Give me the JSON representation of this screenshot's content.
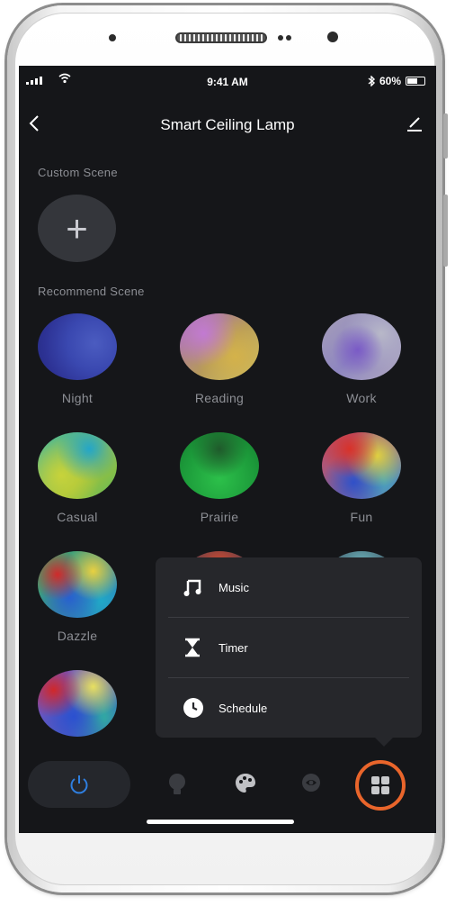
{
  "status_bar": {
    "time": "9:41 AM",
    "battery": "60%",
    "battery_level": 0.6
  },
  "header": {
    "title": "Smart Ceiling Lamp",
    "back_icon": "chevron-left-icon",
    "edit_icon": "pencil-icon"
  },
  "custom_scene": {
    "heading": "Custom Scene",
    "add_symbol": "+"
  },
  "recommend_scene": {
    "heading": "Recommend Scene",
    "scenes": [
      {
        "label": "Night"
      },
      {
        "label": "Reading"
      },
      {
        "label": "Work"
      },
      {
        "label": "Casual"
      },
      {
        "label": "Prairie"
      },
      {
        "label": "Fun"
      },
      {
        "label": "Dazzle"
      }
    ]
  },
  "popup_menu": {
    "items": [
      {
        "label": "Music",
        "icon": "music-note-icon"
      },
      {
        "label": "Timer",
        "icon": "hourglass-icon"
      },
      {
        "label": "Schedule",
        "icon": "clock-icon"
      }
    ]
  },
  "tab_bar": {
    "tabs": [
      {
        "icon": "power-icon"
      },
      {
        "icon": "bulb-icon"
      },
      {
        "icon": "palette-icon"
      },
      {
        "icon": "eye-icon"
      },
      {
        "icon": "grid-icon",
        "active": true
      }
    ]
  },
  "colors": {
    "accent": "#e9652b",
    "background": "#151619",
    "power_blue": "#2f7fe0"
  }
}
